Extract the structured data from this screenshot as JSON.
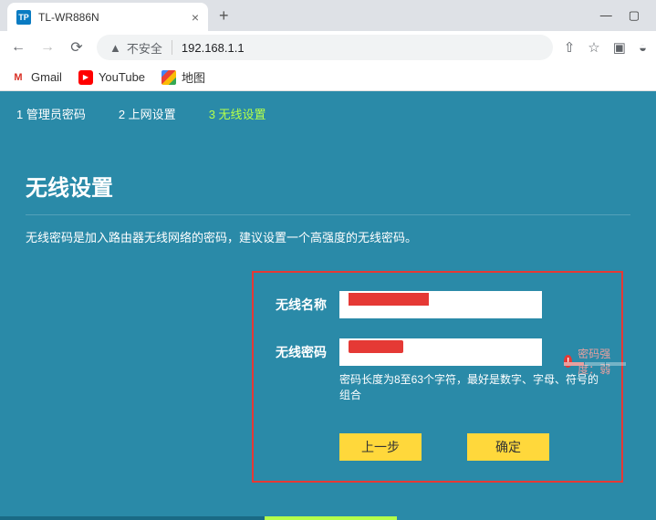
{
  "browser": {
    "tab_title": "TL-WR886N",
    "tab_favicon": "TP",
    "security_label": "不安全",
    "url": "192.168.1.1"
  },
  "bookmarks": {
    "gmail": "Gmail",
    "youtube": "YouTube",
    "maps": "地图"
  },
  "wizard": {
    "step1": "1 管理员密码",
    "step2": "2 上网设置",
    "step3": "3 无线设置"
  },
  "page": {
    "title": "无线设置",
    "description": "无线密码是加入路由器无线网络的密码，建议设置一个高强度的无线密码。"
  },
  "form": {
    "ssid_label": "无线名称",
    "ssid_value": "",
    "password_label": "无线密码",
    "password_value": "",
    "password_hint": "密码长度为8至63个字符，最好是数字、字母、符号的组合",
    "strength_prefix": "密码强度：",
    "strength_value": "弱",
    "prev_btn": "上一步",
    "confirm_btn": "确定"
  }
}
